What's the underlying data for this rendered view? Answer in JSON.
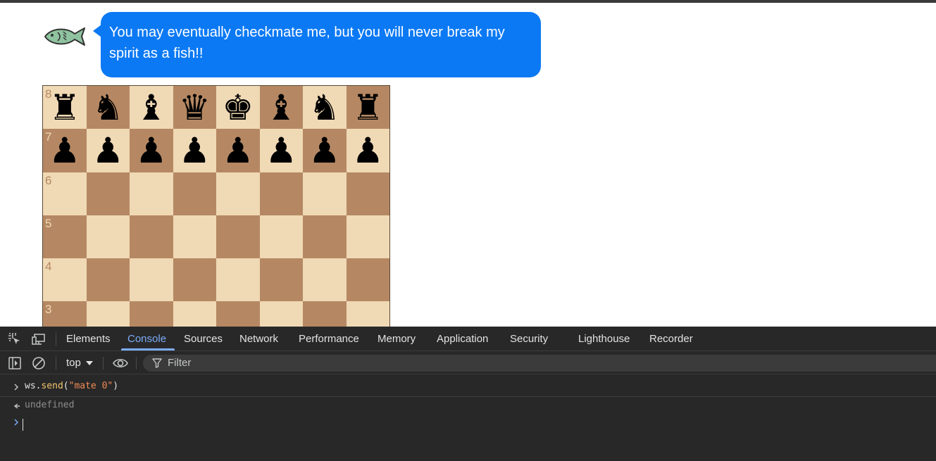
{
  "chat": {
    "avatar_icon": "fish-icon",
    "message": "You may eventually checkmate me, but you will never break my spirit as a fish!!",
    "bubble_color": "#0b79f4"
  },
  "board": {
    "light_color": "#f0d9b5",
    "dark_color": "#b58863",
    "ranks": [
      {
        "label": "8",
        "pieces": [
          "♜",
          "♞",
          "♝",
          "♛",
          "♚",
          "♝",
          "♞",
          "♜"
        ]
      },
      {
        "label": "7",
        "pieces": [
          "♟",
          "♟",
          "♟",
          "♟",
          "♟",
          "♟",
          "♟",
          "♟"
        ]
      },
      {
        "label": "6",
        "pieces": [
          "",
          "",
          "",
          "",
          "",
          "",
          "",
          ""
        ]
      },
      {
        "label": "5",
        "pieces": [
          "",
          "",
          "",
          "",
          "",
          "",
          "",
          ""
        ]
      },
      {
        "label": "4",
        "pieces": [
          "",
          "",
          "",
          "",
          "",
          "",
          "",
          ""
        ]
      },
      {
        "label": "3",
        "pieces": [
          "",
          "",
          "",
          "",
          "",
          "",
          "",
          ""
        ]
      }
    ]
  },
  "devtools": {
    "tabs": [
      "Elements",
      "Console",
      "Sources",
      "Network",
      "Performance",
      "Memory",
      "Application",
      "Security",
      "Lighthouse",
      "Recorder"
    ],
    "active_tab": "Console",
    "context": "top",
    "filter_placeholder": "Filter",
    "console": {
      "input": {
        "obj": "ws",
        "dot": ".",
        "fn": "send",
        "open": "(",
        "arg": "\"mate 0\"",
        "close": ")"
      },
      "result": "undefined"
    }
  }
}
